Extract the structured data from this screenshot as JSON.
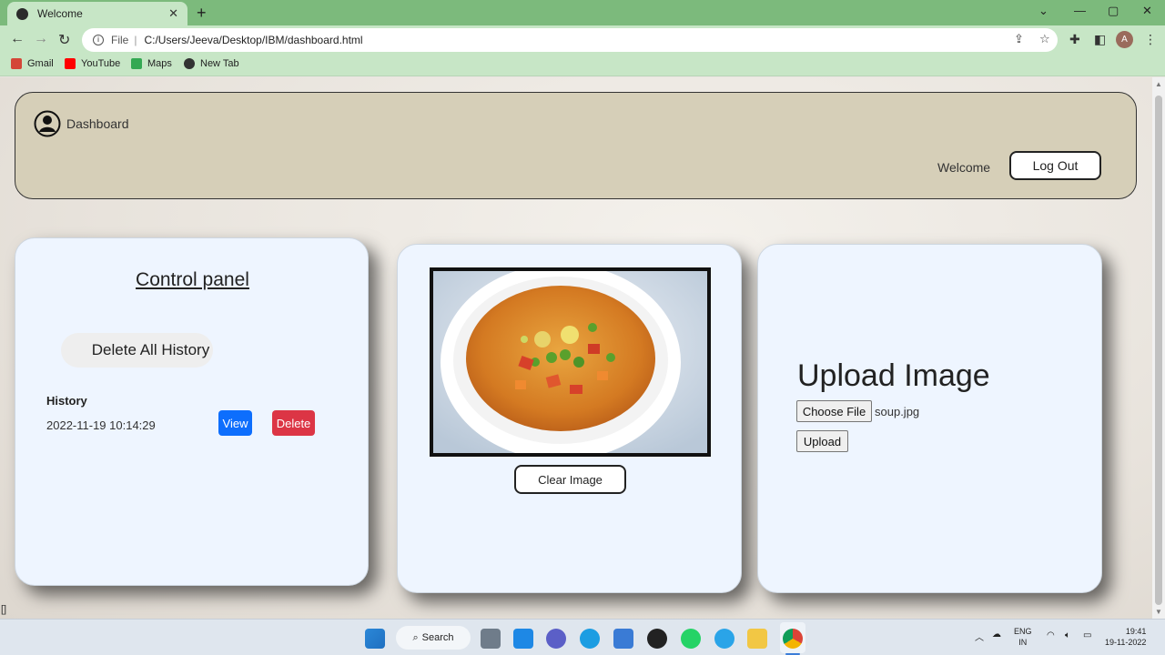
{
  "browser": {
    "tab_title": "Welcome",
    "new_tab": "+",
    "close_tab": "✕",
    "url_scheme": "File",
    "url_path": "C:/Users/Jeeva/Desktop/IBM/dashboard.html",
    "profile_initial": "A",
    "bookmarks": [
      "Gmail",
      "YouTube",
      "Maps",
      "New Tab"
    ]
  },
  "header": {
    "dashboard_label": "Dashboard",
    "welcome_text": "Welcome",
    "logout_label": "Log Out"
  },
  "control_panel": {
    "title": "Control panel",
    "delete_all_label": "Delete All History",
    "history_label": "History",
    "history_items": [
      {
        "date": "2022-11-19 10:14:29",
        "view_label": "View",
        "delete_label": "Delete"
      }
    ]
  },
  "image_panel": {
    "clear_label": "Clear Image"
  },
  "upload_panel": {
    "title": "Upload Image",
    "choose_label": "Choose File",
    "file_name": "soup.jpg",
    "upload_label": "Upload"
  },
  "page_corner_text": "[]",
  "taskbar": {
    "search_label": "Search",
    "lang_top": "ENG",
    "lang_bottom": "IN",
    "time": "19:41",
    "date": "19-11-2022"
  },
  "colors": {
    "tab_bar": "#7cba7c",
    "toolbar": "#c7e6c6",
    "header_bg": "#d6cfb8",
    "panel_bg": "#eef5ff",
    "view_btn": "#0d6efd",
    "delete_btn": "#dc3545"
  }
}
